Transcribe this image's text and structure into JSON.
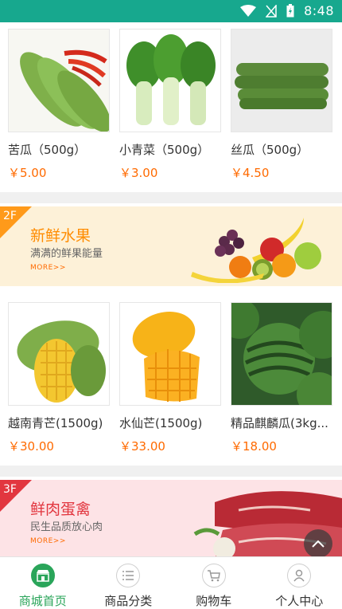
{
  "status_bar": {
    "time": "8:48"
  },
  "floor1_products": [
    {
      "name": "苦瓜（500g）",
      "price": "￥5.00",
      "image": "bitter-melon"
    },
    {
      "name": "小青菜（500g）",
      "price": "￥3.00",
      "image": "bok-choy"
    },
    {
      "name": "丝瓜（500g）",
      "price": "￥4.50",
      "image": "luffa"
    }
  ],
  "banner_fruit": {
    "floor": "2F",
    "title": "新鲜水果",
    "subtitle": "满满的鲜果能量",
    "more": "MORE>>"
  },
  "floor2_products": [
    {
      "name": "越南青芒(1500g)",
      "price": "￥30.00",
      "image": "green-mango"
    },
    {
      "name": "水仙芒(1500g)",
      "price": "￥33.00",
      "image": "yellow-mango"
    },
    {
      "name": "精品麒麟瓜(3kg...",
      "price": "￥18.00",
      "image": "watermelon"
    }
  ],
  "banner_meat": {
    "floor": "3F",
    "title": "鲜肉蛋禽",
    "subtitle": "民生品质放心肉",
    "more": "MORE>>"
  },
  "tabbar": [
    {
      "label": "商城首页",
      "icon": "store-icon",
      "active": true
    },
    {
      "label": "商品分类",
      "icon": "list-icon",
      "active": false
    },
    {
      "label": "购物车",
      "icon": "cart-icon",
      "active": false
    },
    {
      "label": "个人中心",
      "icon": "user-icon",
      "active": false
    }
  ],
  "colors": {
    "status_bar": "#17a88e",
    "price": "#ff6a00",
    "active_tab": "#2aa55a"
  }
}
